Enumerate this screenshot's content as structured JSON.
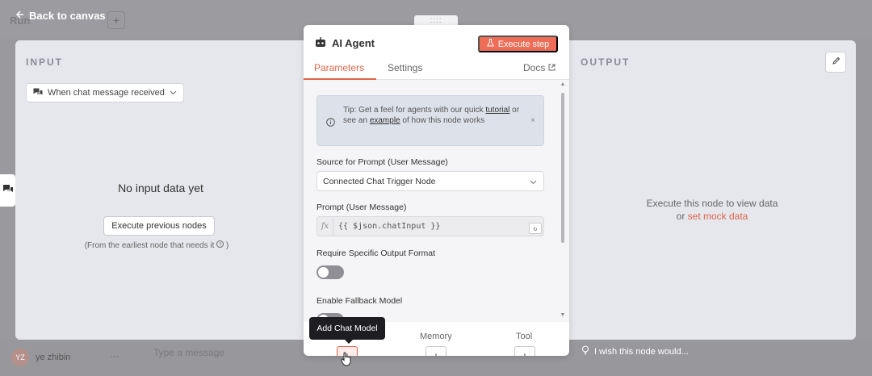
{
  "background": {
    "back_label": "Back to canvas",
    "faint_title": "Run",
    "user_initials": "YZ",
    "user_name": "ye zhibin",
    "user_more": "···",
    "type_message_placeholder": "Type a message",
    "wish_text": "I wish this node would..."
  },
  "input_panel": {
    "label": "INPUT",
    "trigger_select_value": "When chat message received",
    "empty_title": "No input data yet",
    "execute_previous_label": "Execute previous nodes",
    "earliest_note": "(From the earliest node that needs it",
    "earliest_note_close": " )"
  },
  "output_panel": {
    "label": "OUTPUT",
    "exec_text": "Execute this node to view data",
    "or_text": "or ",
    "mock_link": "set mock data"
  },
  "modal": {
    "drag_handle": "::::",
    "title": "AI Agent",
    "execute_step_label": "Execute step",
    "tabs": [
      {
        "label": "Parameters",
        "active": true
      },
      {
        "label": "Settings",
        "active": false
      }
    ],
    "docs_label": "Docs",
    "tip": {
      "prefix": "Tip: Get a feel for agents with our quick ",
      "link1": "tutorial",
      "middle": " or see an ",
      "link2": "example",
      "suffix": " of how this node works",
      "close": "×"
    },
    "source_label": "Source for Prompt (User Message)",
    "source_value": "Connected Chat Trigger Node",
    "prompt_label": "Prompt (User Message)",
    "prompt_fx": "fx",
    "prompt_value": "{{ $json.chatInput }}",
    "require_output_label": "Require Specific Output Format",
    "fallback_label": "Enable Fallback Model",
    "sub_nodes": [
      "Chat Model",
      "Memory",
      "Tool"
    ],
    "tooltip": "Add Chat Model",
    "plus": "+"
  },
  "colors": {
    "accent": "#e0654b",
    "execute_step_bg": "#ef6c57",
    "panel_bg": "#e6e7ec"
  }
}
